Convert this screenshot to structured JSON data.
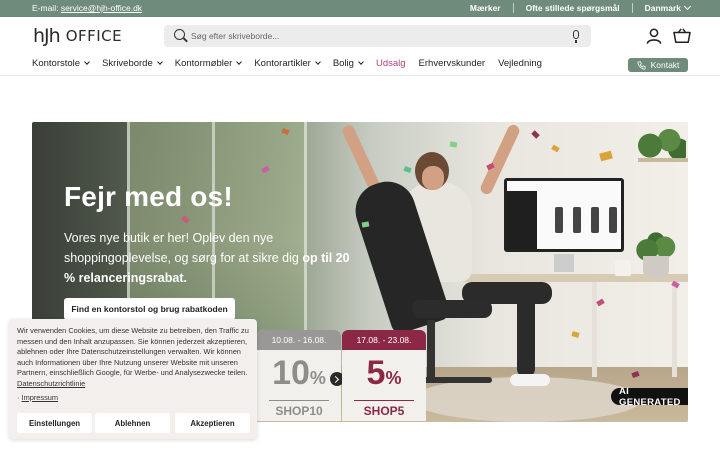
{
  "topbar": {
    "email_prefix": "E-mail: ",
    "email": "service@hjh-office.dk",
    "links": [
      "Mærker",
      "Ofte stillede spørgsmål"
    ],
    "country": "Danmark"
  },
  "header": {
    "logo_mark": "hJh",
    "logo_word": "OFFICE",
    "search_placeholder": "Søg efter skriveborde..."
  },
  "nav": {
    "items": [
      {
        "label": "Kontorstole",
        "dropdown": true
      },
      {
        "label": "Skriveborde",
        "dropdown": true
      },
      {
        "label": "Kontormøbler",
        "dropdown": true
      },
      {
        "label": "Kontorartikler",
        "dropdown": true
      },
      {
        "label": "Bolig",
        "dropdown": true
      },
      {
        "label": "Udsalg",
        "dropdown": false
      },
      {
        "label": "Erhvervskunder",
        "dropdown": false
      },
      {
        "label": "Vejledning",
        "dropdown": false
      }
    ],
    "contact_label": "Kontakt"
  },
  "hero": {
    "title": "Fejr med os!",
    "text_1": "Vores nye butik er her! Oplev den nye shoppingoplevelse, og sørg for at sikre dig ",
    "text_bold": "op til 20 % relanceringsrabat.",
    "button": "Find en kontorstol og brug rabatkoden",
    "ai_badge": "AI GENERATED",
    "promos": [
      {
        "dates": "10.08. - 16.08.",
        "value": "10",
        "unit": "%",
        "code": "SHOP10",
        "head_color": "#9a9896",
        "text_color": "#8f8d8a"
      },
      {
        "dates": "17.08. - 23.08.",
        "value": "5",
        "unit": "%",
        "code": "SHOP5",
        "head_color": "#8b2846",
        "text_color": "#8b2846"
      }
    ]
  },
  "cookie": {
    "text": "Wir verwenden Cookies, um diese Website zu betreiben, den Traffic zu messen und den Inhalt anzupassen. Sie können jederzeit akzeptieren, ablehnen oder Ihre Datenschutzeinstellungen verwalten. Wir können auch Informationen über Ihre Nutzung unserer Website mit unseren Partnern, einschließlich Google, für Werbe- und Analysezwecke teilen. ",
    "privacy_link": "Datenschutzrichtlinie",
    "imprint_prefix": "· ",
    "imprint_link": "Impressum",
    "buttons": {
      "settings": "Einstellungen",
      "reject": "Ablehnen",
      "accept": "Akzeptieren"
    }
  },
  "colors": {
    "brand": "#6e8b7c",
    "sale": "#b2417e",
    "shop5": "#8b2846"
  },
  "icons": [
    "search-icon",
    "microphone-icon",
    "user-icon",
    "cart-icon",
    "phone-icon",
    "chevron-down-icon",
    "chevron-right-icon"
  ]
}
